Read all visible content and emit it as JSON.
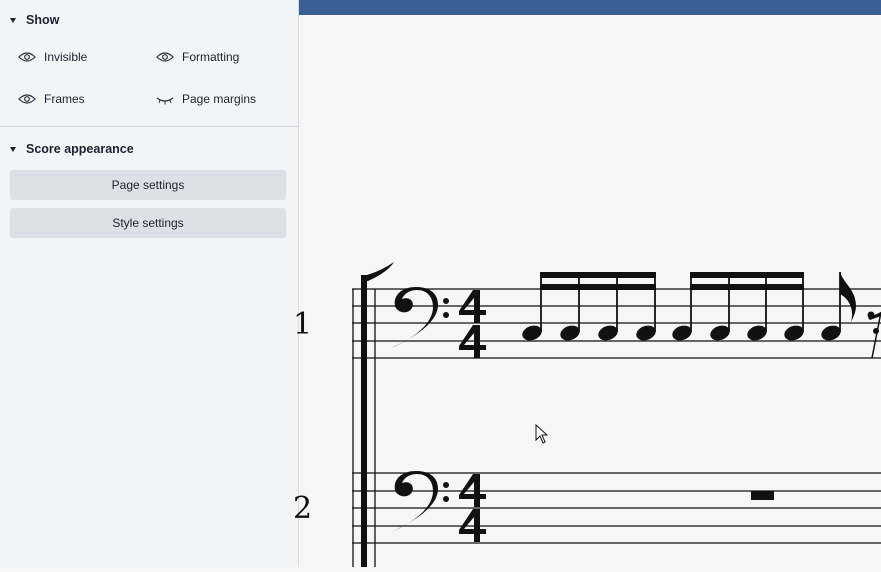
{
  "sidebar": {
    "show": {
      "title": "Show",
      "items": [
        {
          "label": "Invisible",
          "icon": "eye-icon"
        },
        {
          "label": "Formatting",
          "icon": "eye-icon"
        },
        {
          "label": "Frames",
          "icon": "eye-icon"
        },
        {
          "label": "Page margins",
          "icon": "eye-closed-icon"
        }
      ]
    },
    "score_appearance": {
      "title": "Score appearance",
      "page_settings": "Page settings",
      "style_settings": "Style settings"
    }
  },
  "score": {
    "staves": [
      {
        "number": "1",
        "clef": "bass",
        "time_signature": "4/4"
      },
      {
        "number": "2",
        "clef": "bass",
        "time_signature": "4/4"
      }
    ]
  },
  "colors": {
    "topbar": "#3a5f93",
    "sidebar_bg": "#f3f4f6",
    "button_bg": "#dce0e7"
  }
}
